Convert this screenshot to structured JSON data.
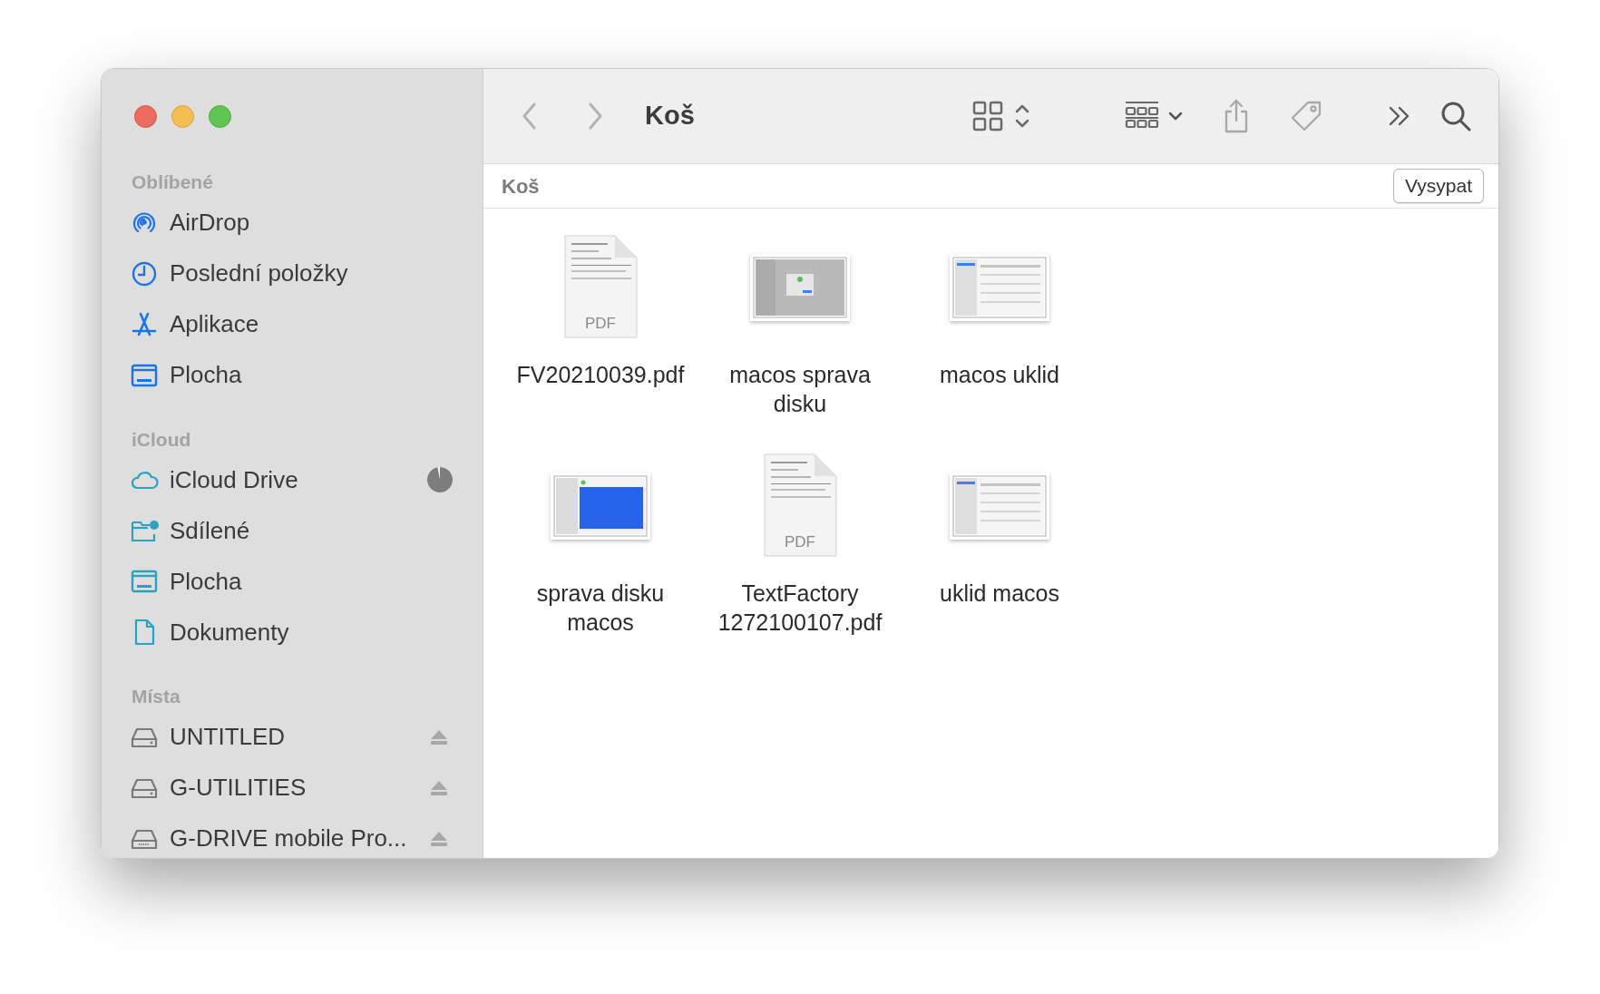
{
  "sidebar": {
    "sections": [
      {
        "heading": "Oblíbené",
        "kind": "favorites",
        "items": [
          {
            "label": "AirDrop",
            "kind": "airdrop"
          },
          {
            "label": "Poslední položky",
            "kind": "recent"
          },
          {
            "label": "Aplikace",
            "kind": "apps"
          },
          {
            "label": "Plocha",
            "kind": "desktop"
          }
        ]
      },
      {
        "heading": "iCloud",
        "kind": "icloud",
        "items": [
          {
            "label": "iCloud Drive",
            "kind": "cloud",
            "level": 0.97
          },
          {
            "label": "Sdílené",
            "kind": "shared"
          },
          {
            "label": "Plocha",
            "kind": "desktop"
          },
          {
            "label": "Dokumenty",
            "kind": "document"
          }
        ]
      },
      {
        "heading": "Místa",
        "kind": "locations",
        "items": [
          {
            "label": "UNTITLED",
            "kind": "drive",
            "ejectable": true
          },
          {
            "label": "G-UTILITIES",
            "kind": "drive",
            "ejectable": true
          },
          {
            "label": "G-DRIVE mobile Pro...",
            "kind": "external-drive",
            "ejectable": true
          }
        ]
      }
    ]
  },
  "toolbar": {
    "title": "Koš"
  },
  "path_bar": {
    "location": "Koš",
    "button": "Vysypat"
  },
  "files": [
    {
      "name": "FV20210039.pdf",
      "kind": "pdf",
      "badge": "PDF"
    },
    {
      "name": "macos sprava disku",
      "kind": "dialog-shot"
    },
    {
      "name": "macos uklid",
      "kind": "window-shot"
    },
    {
      "name": "sprava disku macos",
      "kind": "selection-shot"
    },
    {
      "name": "TextFactory 1272100107.pdf",
      "kind": "pdf",
      "badge": "PDF"
    },
    {
      "name": "uklid macos",
      "kind": "window-shot"
    }
  ]
}
